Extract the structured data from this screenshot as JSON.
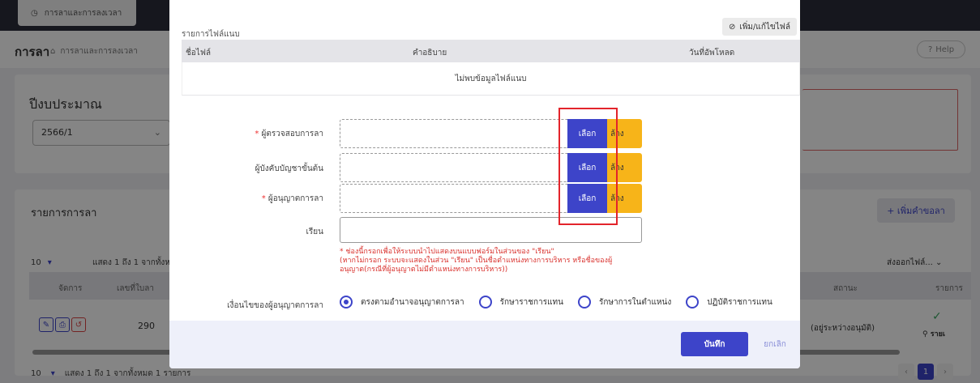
{
  "background": {
    "top_tab": "การลาและการลงเวลา",
    "breadcrumb_title": "การลา",
    "breadcrumb_path": "การลาและการลงเวลา",
    "help_label": "Help",
    "budget_title": "ปีงบประมาณ",
    "budget_value": "2566/1",
    "leave_list_title": "รายการการลา",
    "add_request_label": "+ เพิ่มคำขอลา",
    "page_size": "10",
    "showing_text": "แสดง 1 ถึง 1 จากทั้งห",
    "export_label": "ส่งออกไฟล์...",
    "columns": {
      "manage": "จัดการ",
      "leave_no": "เลขที่ใบลา",
      "status": "สถานะ",
      "detail": "รายการ"
    },
    "row": {
      "leave_no": "290",
      "status": "(อยู่ระหว่างอนุมัติ)",
      "detail": "รายเ"
    },
    "footer_showing": "แสดง 1 ถึง 1 จากทั้งหมด 1 รายการ",
    "current_page": "1"
  },
  "modal": {
    "attachments_title": "รายการไฟล์แนบ",
    "attach_edit_label": "เพิ่ม/แก้ไขไฟล์",
    "attach_columns": {
      "filename": "ชื่อไฟล์",
      "description": "คำอธิบาย",
      "uploaded": "วันที่อัพโหลด"
    },
    "attach_empty": "ไม่พบข้อมูลไฟล์แนบ",
    "fields": [
      {
        "label": "ผู้ตรวจสอบการลา",
        "required": "* "
      },
      {
        "label": "ผู้บังคับบัญชาขั้นต้น",
        "required": ""
      },
      {
        "label": "ผู้อนุญาตการลา",
        "required": "* "
      }
    ],
    "pick_label": "เลือก",
    "clear_label": "ล้าง",
    "dear_label": "เรียน",
    "dear_value": "",
    "hint_lines": [
      "* ช่องนี้กรอกเพื่อให้ระบบนำไปแสดงบนแบบฟอร์มในส่วนของ \"เรียน\"",
      "(หากไม่กรอก ระบบจะแสดงในส่วน \"เรียน\" เป็นชื่อตำแหน่งทางการบริหาร หรือชื่อของผู้",
      "อนุญาต(กรณีที่ผู้อนุญาตไม่มีตำแหน่งทางการบริหาร))"
    ],
    "condition_label": "เงื่อนไขของผู้อนุญาตการลา",
    "conditions": [
      {
        "label": "ตรงตามอำนาจอนุญาตการลา",
        "selected": "yes"
      },
      {
        "label": "รักษาราชการแทน",
        "selected": "no"
      },
      {
        "label": "รักษาการในตำแหน่ง",
        "selected": "no"
      },
      {
        "label": "ปฏิบัติราชการแทน",
        "selected": "no"
      }
    ],
    "save_label": "บันทึก",
    "cancel_label": "ยกเลิก"
  },
  "colors": {
    "primary": "#3d44c9",
    "warning": "#f7b419",
    "danger": "#e3242b"
  }
}
